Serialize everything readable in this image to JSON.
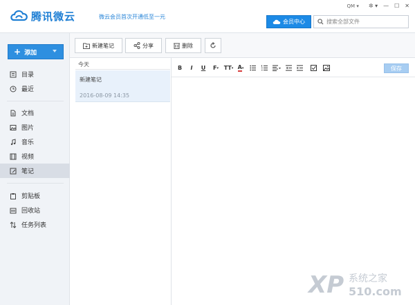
{
  "app": {
    "name": "腾讯微云",
    "promo": "微云会员首次开通低至一元",
    "user": "QM",
    "member_center": "会员中心",
    "search_placeholder": "搜索全部文件"
  },
  "sidebar": {
    "add_label": "添加",
    "groups": [
      [
        {
          "label": "目录",
          "icon": "directory-icon"
        },
        {
          "label": "最近",
          "icon": "clock-icon"
        }
      ],
      [
        {
          "label": "文档",
          "icon": "document-icon"
        },
        {
          "label": "图片",
          "icon": "image-icon"
        },
        {
          "label": "音乐",
          "icon": "music-icon"
        },
        {
          "label": "视频",
          "icon": "video-icon"
        },
        {
          "label": "笔记",
          "icon": "note-icon",
          "active": true
        }
      ],
      [
        {
          "label": "剪贴板",
          "icon": "clipboard-icon"
        },
        {
          "label": "回收站",
          "icon": "trash-icon"
        },
        {
          "label": "任务列表",
          "icon": "transfer-icon"
        }
      ]
    ]
  },
  "toolbar": {
    "new_note": "新建笔记",
    "share": "分享",
    "delete": "删除"
  },
  "notes": {
    "group": "今天",
    "items": [
      {
        "title": "新建笔记",
        "date": "2016-08-09 14:35"
      }
    ]
  },
  "editor": {
    "save": "保存",
    "tools": [
      "B",
      "I",
      "U",
      "F",
      "TT",
      "A"
    ]
  },
  "watermark": {
    "text": "系统之家",
    "brand": "XP",
    "domain": "510.com"
  },
  "colors": {
    "brand_blue": "#1f7fd4",
    "member_blue": "#1c8ae6",
    "save_blue": "#a7cdf2"
  }
}
